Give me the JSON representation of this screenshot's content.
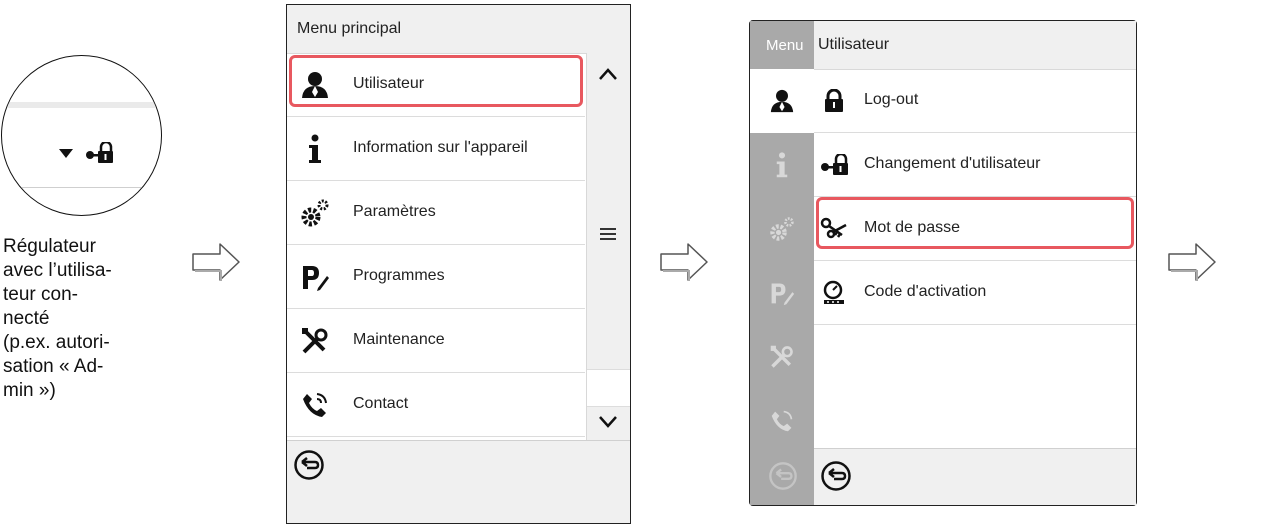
{
  "caption": {
    "lines": [
      "Régulateur",
      "avec l’utilisa-",
      "teur con-",
      "necté",
      "(p.ex. autori-",
      "sation « Ad-",
      "min »)"
    ]
  },
  "zoom": {
    "icons": [
      "dropdown-triangle-icon",
      "user-key-lock-icon"
    ]
  },
  "panel1": {
    "title": "Menu principal",
    "items": [
      {
        "label": "Utilisateur",
        "icon": "user-icon"
      },
      {
        "label": "Information sur l'appareil",
        "icon": "info-icon"
      },
      {
        "label": "Paramètres",
        "icon": "gears-icon"
      },
      {
        "label": "Programmes",
        "icon": "program-icon"
      },
      {
        "label": "Maintenance",
        "icon": "tools-icon"
      },
      {
        "label": "Contact",
        "icon": "phone-icon"
      }
    ],
    "scroll_icons": [
      "scroll-up-icon",
      "scroll-menu-icon",
      "scroll-down-icon"
    ],
    "back_icon": "back-icon"
  },
  "panel2": {
    "menu_label": "Menu",
    "title": "Utilisateur",
    "items": [
      {
        "label": "Log-out",
        "icon": "lock-icon"
      },
      {
        "label": "Changement d'utilisateur",
        "icon": "user-key-lock-icon"
      },
      {
        "label": "Mot de passe",
        "icon": "keys-icon"
      },
      {
        "label": "Code d'activation",
        "icon": "activation-code-icon"
      }
    ],
    "back_icon": "back-icon"
  },
  "colors": {
    "highlight": "#e8585f",
    "header_bg": "#f0f0f0",
    "strip_bg": "#a9a9a9"
  }
}
